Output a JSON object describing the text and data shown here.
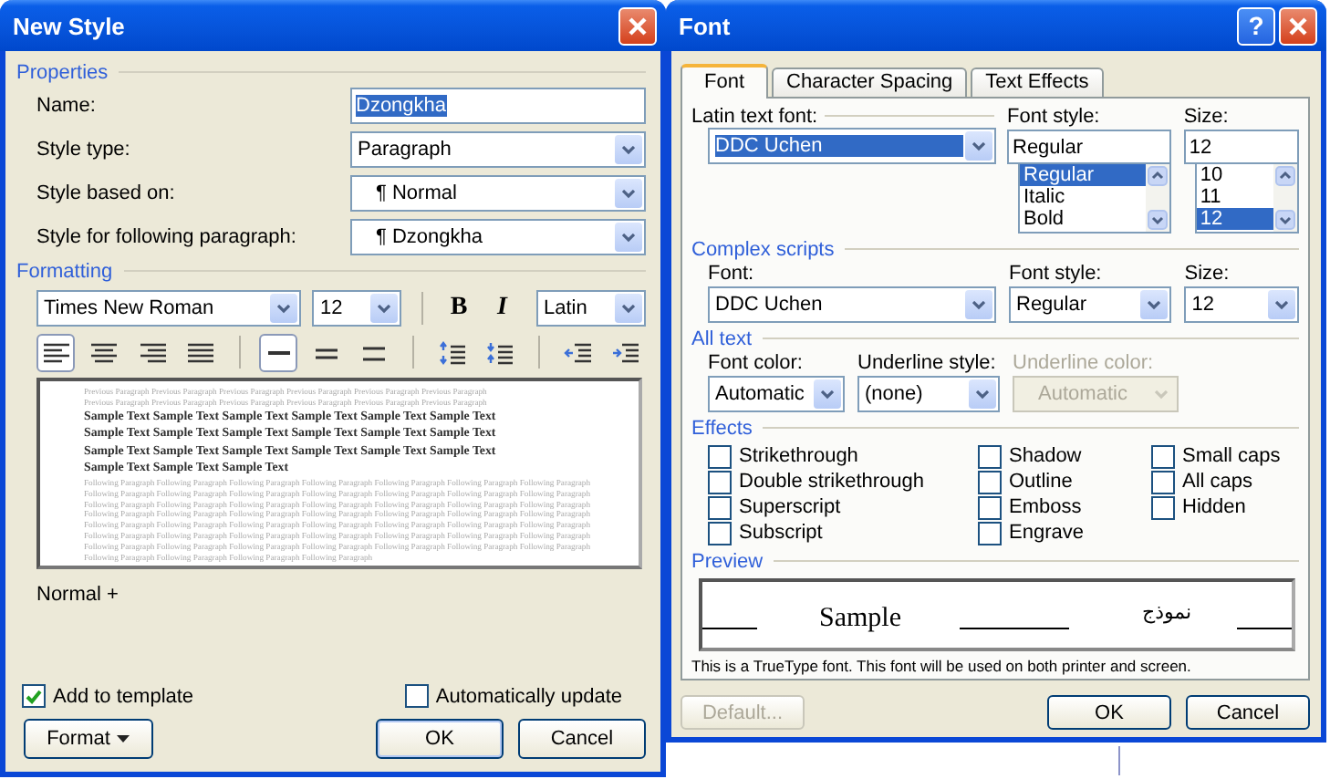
{
  "new_style": {
    "title": "New Style",
    "properties": {
      "heading": "Properties",
      "rows": [
        {
          "kind": "text",
          "label": "Name:",
          "value": "Dzongkha",
          "text_selected": true
        },
        {
          "kind": "dropdown",
          "label": "Style type:",
          "value": "Paragraph"
        },
        {
          "kind": "dropdown",
          "label": "Style based on:",
          "value": "¶ Normal"
        },
        {
          "kind": "dropdown",
          "label": "Style for following paragraph:",
          "value": "¶ Dzongkha"
        }
      ]
    },
    "formatting": {
      "heading": "Formatting",
      "font": "Times New Roman",
      "size": "12",
      "bold": "B",
      "italic": "I",
      "script": "Latin",
      "tools": [
        {
          "kind": "align-left",
          "selected": true
        },
        {
          "kind": "align-center",
          "selected": false
        },
        {
          "kind": "align-right",
          "selected": false
        },
        {
          "kind": "justify",
          "selected": false
        },
        {
          "kind": "single-spacing",
          "selected": true
        },
        {
          "kind": "one-half-spacing",
          "selected": false
        },
        {
          "kind": "double-spacing",
          "selected": false
        },
        {
          "kind": "space-increase",
          "selected": false
        },
        {
          "kind": "space-decrease",
          "selected": false
        },
        {
          "kind": "indent-decrease",
          "selected": false
        },
        {
          "kind": "indent-increase",
          "selected": false
        }
      ],
      "preview": {
        "previous": [
          "Previous Paragraph Previous Paragraph Previous Paragraph Previous Paragraph Previous Paragraph Previous Paragraph",
          "Previous Paragraph Previous Paragraph Previous Paragraph Previous Paragraph Previous Paragraph Previous Paragraph"
        ],
        "sample": [
          "Sample Text Sample Text Sample Text Sample Text Sample Text Sample Text",
          "Sample Text Sample Text Sample Text Sample Text Sample Text Sample Text",
          "Sample Text Sample Text Sample Text Sample Text Sample Text Sample Text",
          "Sample Text Sample Text Sample Text"
        ],
        "following": [
          "Following Paragraph Following Paragraph Following Paragraph Following Paragraph Following Paragraph Following Paragraph Following Paragraph",
          "Following Paragraph Following Paragraph Following Paragraph Following Paragraph Following Paragraph Following Paragraph Following Paragraph",
          "Following Paragraph Following Paragraph Following Paragraph Following Paragraph Following Paragraph Following Paragraph Following Paragraph",
          "Following Paragraph Following Paragraph Following Paragraph Following Paragraph Following Paragraph Following Paragraph Following Paragraph",
          "Following Paragraph Following Paragraph Following Paragraph Following Paragraph Following Paragraph Following Paragraph Following Paragraph",
          "Following Paragraph Following Paragraph Following Paragraph Following Paragraph Following Paragraph Following Paragraph Following Paragraph",
          "Following Paragraph Following Paragraph Following Paragraph Following Paragraph Following Paragraph Following Paragraph Following Paragraph",
          "Following Paragraph Following Paragraph Following Paragraph Following Paragraph"
        ]
      },
      "description": "Normal +"
    },
    "checkboxes": [
      {
        "label": "Add to template",
        "checked": true
      },
      {
        "label": "Automatically update",
        "checked": false
      }
    ],
    "buttons": [
      {
        "kind": "menu",
        "label": "Format"
      },
      {
        "kind": "default",
        "label": "OK"
      },
      {
        "kind": "plain",
        "label": "Cancel"
      }
    ]
  },
  "font_dialog": {
    "title": "Font",
    "help": "?",
    "tabs": [
      {
        "label": "Font",
        "selected": true
      },
      {
        "label": "Character Spacing",
        "selected": false
      },
      {
        "label": "Text Effects",
        "selected": false
      }
    ],
    "latin": {
      "font_label": "Latin text font:",
      "font": "DDC Uchen",
      "text_selected": true,
      "style_label": "Font style:",
      "style": "Regular",
      "styles": [
        {
          "label": "Regular",
          "selected": true
        },
        {
          "label": "Italic",
          "selected": false
        },
        {
          "label": "Bold",
          "selected": false
        }
      ],
      "size_label": "Size:",
      "size": "12",
      "sizes": [
        {
          "label": "10",
          "selected": false
        },
        {
          "label": "11",
          "selected": false
        },
        {
          "label": "12",
          "selected": true
        }
      ]
    },
    "complex": {
      "heading": "Complex scripts",
      "font_label": "Font:",
      "font": "DDC Uchen",
      "style_label": "Font style:",
      "style": "Regular",
      "size_label": "Size:",
      "size": "12"
    },
    "all_text": {
      "heading": "All text",
      "fields": [
        {
          "label": "Font color:",
          "value": "Automatic",
          "disabled": false
        },
        {
          "label": "Underline style:",
          "value": "(none)",
          "disabled": false
        },
        {
          "label": "Underline color:",
          "value": "Automatic",
          "disabled": true
        }
      ]
    },
    "effects": {
      "heading": "Effects",
      "columns": [
        [
          {
            "label": "Strikethrough",
            "checked": false
          },
          {
            "label": "Double strikethrough",
            "checked": false
          },
          {
            "label": "Superscript",
            "checked": false
          },
          {
            "label": "Subscript",
            "checked": false
          }
        ],
        [
          {
            "label": "Shadow",
            "checked": false
          },
          {
            "label": "Outline",
            "checked": false
          },
          {
            "label": "Emboss",
            "checked": false
          },
          {
            "label": "Engrave",
            "checked": false
          }
        ],
        [
          {
            "label": "Small caps",
            "checked": false
          },
          {
            "label": "All caps",
            "checked": false
          },
          {
            "label": "Hidden",
            "checked": false
          }
        ]
      ]
    },
    "preview": {
      "heading": "Preview",
      "latin_sample": "Sample",
      "complex_sample": "نموذج",
      "note": "This is a TrueType font. This font will be used on both printer and screen."
    },
    "buttons": [
      {
        "label": "Default...",
        "disabled": true
      },
      {
        "label": "OK",
        "disabled": false
      },
      {
        "label": "Cancel",
        "disabled": false
      }
    ]
  }
}
